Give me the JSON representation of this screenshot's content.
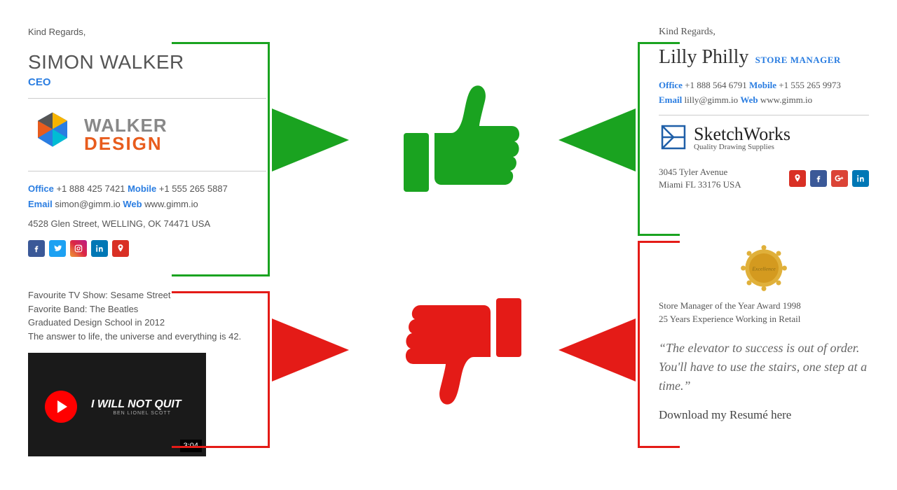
{
  "left": {
    "regards": "Kind Regards,",
    "name": "SIMON WALKER",
    "title": "CEO",
    "logo": {
      "line1": "WALKER",
      "line2": "DESIGN"
    },
    "labels": {
      "office": "Office",
      "mobile": "Mobile",
      "email": "Email",
      "web": "Web"
    },
    "contact": {
      "office": "+1 888 425 7421",
      "mobile": "+1 555 265 5887",
      "email": "simon@gimm.io",
      "web": "www.gimm.io",
      "address": "4528 Glen Street, WELLING, OK 74471 USA"
    },
    "extras": [
      "Favourite TV Show: Sesame Street",
      "Favorite Band: The Beatles",
      "Graduated Design School in 2012",
      "The answer to life, the universe and everything is 42."
    ],
    "video": {
      "title": "I WILL NOT QUIT",
      "author": "BEN LIONEL SCOTT",
      "duration": "3:04"
    }
  },
  "right": {
    "regards": "Kind Regards,",
    "name": "Lilly Philly",
    "title": "STORE MANAGER",
    "labels": {
      "office": "Office",
      "mobile": "Mobile",
      "email": "Email",
      "web": "Web"
    },
    "contact": {
      "office": "+1 888 564 6791",
      "mobile": "+1 555 265 9973",
      "email": "lilly@gimm.io",
      "web": "www.gimm.io"
    },
    "logo": {
      "brand": "SketchWorks",
      "tag": "Quality Drawing Supplies"
    },
    "address": {
      "line1": "3045 Tyler Avenue",
      "line2": "Miami FL 33176 USA"
    },
    "award_badge": "Excellence",
    "awards": [
      "Store Manager of the Year Award 1998",
      "25 Years Experience Working in Retail"
    ],
    "quote": "“The elevator to success is out of order. You'll have to use the stairs, one step at a time.”",
    "download": "Download my Resumé here"
  }
}
